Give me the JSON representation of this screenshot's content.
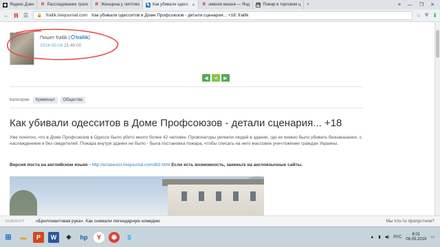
{
  "browser": {
    "tabs": [
      {
        "label": "Яндекс.Дзен",
        "icon": "zen-icon",
        "active": false
      },
      {
        "label": "Расследование траге",
        "icon": "yandex-icon",
        "active": false
      },
      {
        "label": "Женщина у липтово",
        "icon": "yandex-icon",
        "active": false
      },
      {
        "label": "Как убивали одесс",
        "icon": "lj-icon",
        "active": true
      },
      {
        "label": "зимняя вишня — Янд",
        "icon": "yandex-icon",
        "active": false
      },
      {
        "label": "Пожар в торговом ц",
        "icon": "wikipedia-icon",
        "active": false
      }
    ],
    "logo": "Я",
    "url_domain": "frallik.livejournal.com",
    "url_title": "Как убивали одесситов в Доме Профсоюзов - детали сценария... +18: frallik"
  },
  "post": {
    "author_prefix": "Пишет frallik (",
    "author_username": "frallik",
    "author_suffix": ")",
    "date": "2014-05-04",
    "time": "21:46:00",
    "categories_label": "Категории:",
    "categories": [
      "Криминал",
      "Общество"
    ],
    "title": "Как убивали одесситов в Доме Профсоюзов - детали сценария... +18",
    "body": "Уже понятно, что в Доме Профсоюзов в Одессе было убито много более 42 человек. Провокаторы увлекли людей в здание, где их можно было убивать безнаказанно, с наслаждением и без свидетелей. Пожара внутри здания не было - была постановка пожара, чтобы списать на него массовое уничтожение граждан Украины.",
    "english_label": "Версия поста на английском языке - ",
    "english_link": "http://ersieesist.livejournal.com/8t3.html",
    "english_suffix": " Если есть возможность, закиньте на англоязычные сайты."
  },
  "news": {
    "source": "DUBIKVIT",
    "title": "«Бриллиантовая рука». Как снимали легендарную комедию",
    "right": "Мы что-то пропустили?"
  },
  "taskbar": {
    "lang": "РУС",
    "time": "8:01",
    "date": "06.05.2019"
  },
  "colors": {
    "link": "#2a7fbf",
    "share_green": "#4caf50",
    "annotation_red": "#e05050"
  }
}
